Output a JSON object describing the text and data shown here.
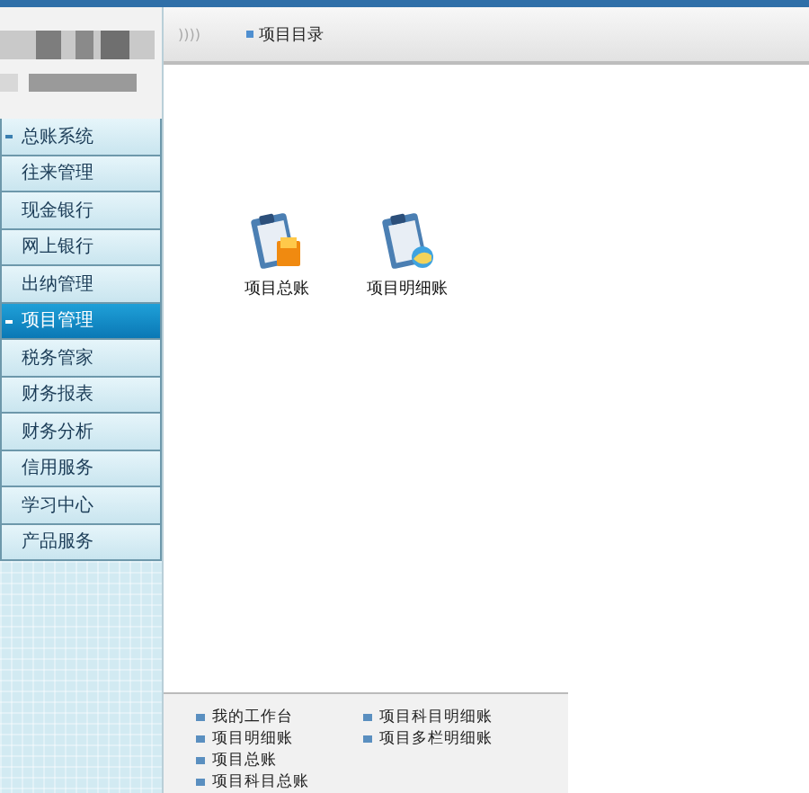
{
  "header": {
    "collapse_icon": "))))",
    "title": "项目目录"
  },
  "sidebar": {
    "items": [
      {
        "label": "总账系统",
        "selected": false,
        "group": true
      },
      {
        "label": "往来管理",
        "selected": false,
        "group": false
      },
      {
        "label": "现金银行",
        "selected": false,
        "group": false
      },
      {
        "label": "网上银行",
        "selected": false,
        "group": false
      },
      {
        "label": "出纳管理",
        "selected": false,
        "group": false
      },
      {
        "label": "项目管理",
        "selected": true,
        "group": true
      },
      {
        "label": "税务管家",
        "selected": false,
        "group": false
      },
      {
        "label": "财务报表",
        "selected": false,
        "group": false
      },
      {
        "label": "财务分析",
        "selected": false,
        "group": false
      },
      {
        "label": "信用服务",
        "selected": false,
        "group": false
      },
      {
        "label": "学习中心",
        "selected": false,
        "group": false
      },
      {
        "label": "产品服务",
        "selected": false,
        "group": false
      }
    ]
  },
  "icons": [
    {
      "label": "项目总账",
      "kind": "ledger"
    },
    {
      "label": "项目明细账",
      "kind": "detail"
    }
  ],
  "quick_links": {
    "column_1": [
      "我的工作台",
      "项目明细账",
      "项目总账",
      "项目科目总账"
    ],
    "column_2": [
      "项目科目明细账",
      "项目多栏明细账"
    ]
  }
}
